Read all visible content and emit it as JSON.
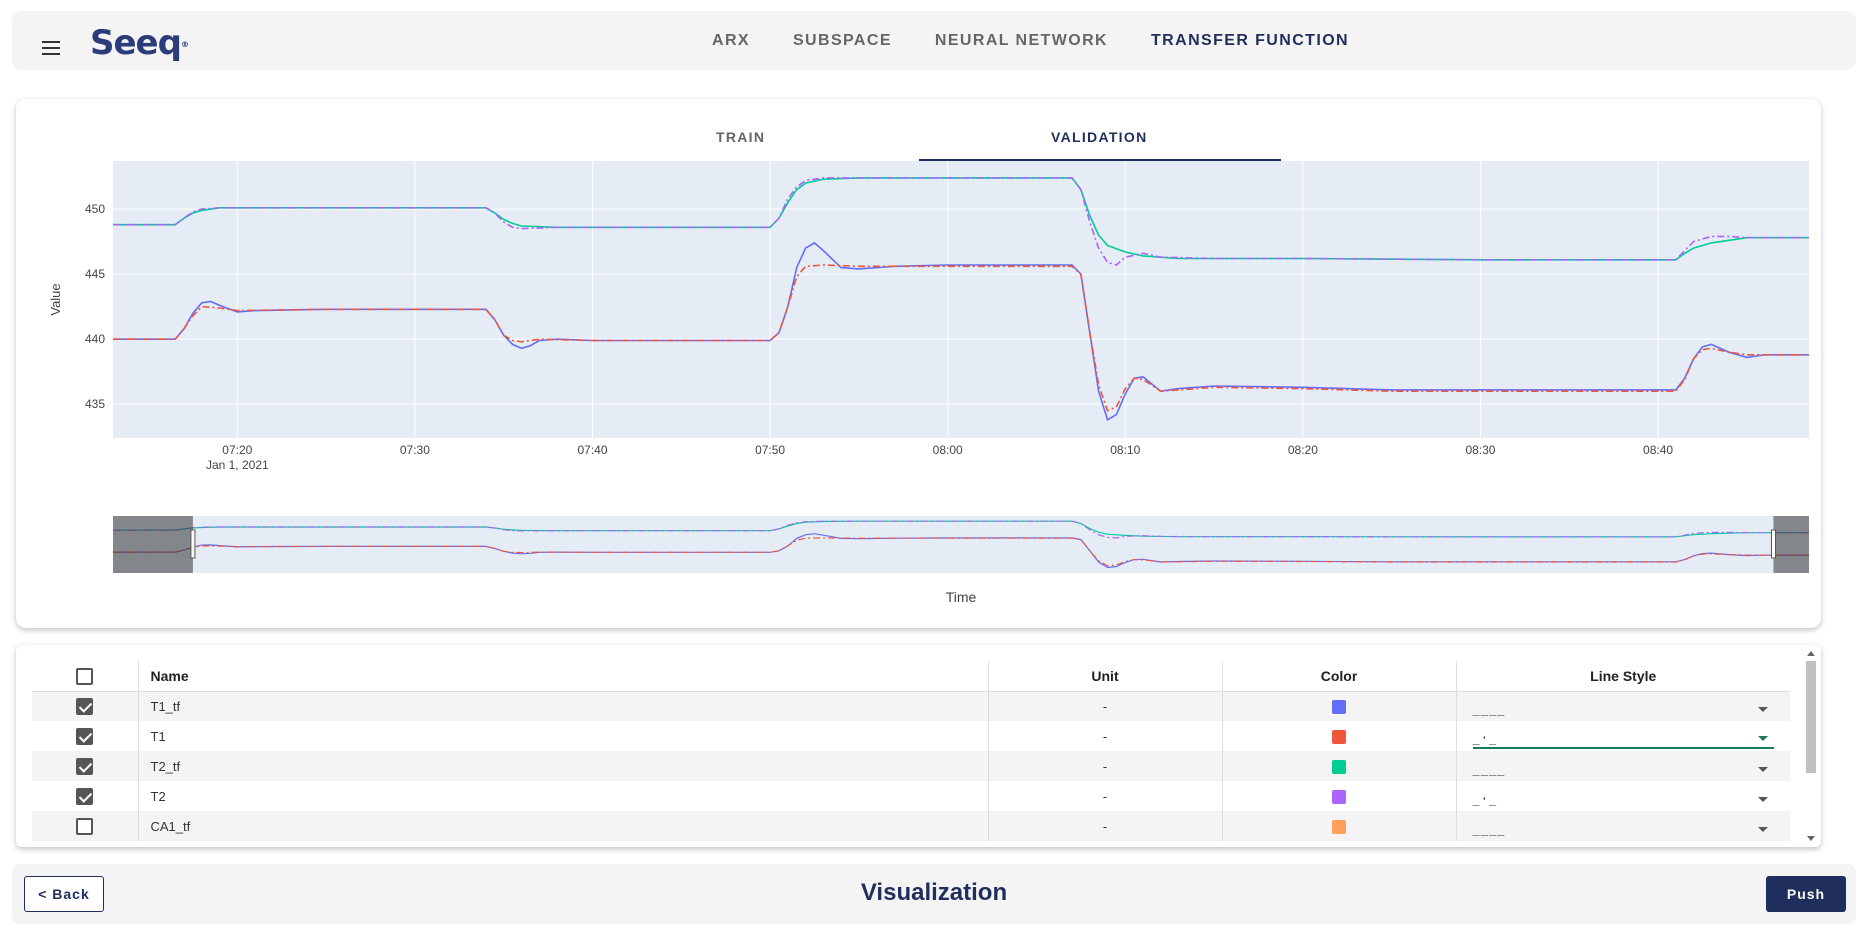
{
  "app": {
    "logo_text": "Seeq"
  },
  "nav": {
    "tabs": [
      {
        "label": "ARX",
        "active": false
      },
      {
        "label": "SUBSPACE",
        "active": false
      },
      {
        "label": "NEURAL NETWORK",
        "active": false
      },
      {
        "label": "TRANSFER FUNCTION",
        "active": true
      }
    ]
  },
  "subtabs": [
    {
      "label": "TRAIN",
      "active": false
    },
    {
      "label": "VALIDATION",
      "active": true
    }
  ],
  "chart_data": {
    "type": "line",
    "xlabel": "Time",
    "ylabel": "Value",
    "x_ticks": [
      "07:20",
      "07:30",
      "07:40",
      "07:50",
      "08:00",
      "08:10",
      "08:20",
      "08:30",
      "08:40"
    ],
    "x_date_label": "Jan 1, 2021",
    "y_ticks": [
      435,
      440,
      445,
      450
    ],
    "xlim": [
      "07:13",
      "08:48.5"
    ],
    "ylim": [
      432.4,
      453.7
    ],
    "grid": true,
    "rangeslider": true,
    "series": [
      {
        "name": "T1_tf",
        "color": "#636efa",
        "dash": "solid",
        "points": [
          [
            "07:13",
            440.0
          ],
          [
            "07:16.5",
            440.0
          ],
          [
            "07:17",
            440.8
          ],
          [
            "07:17.5",
            442.0
          ],
          [
            "07:18",
            442.8
          ],
          [
            "07:18.5",
            442.9
          ],
          [
            "07:19",
            442.6
          ],
          [
            "07:20",
            442.1
          ],
          [
            "07:21",
            442.2
          ],
          [
            "07:25",
            442.3
          ],
          [
            "07:30",
            442.3
          ],
          [
            "07:34",
            442.3
          ],
          [
            "07:34.5",
            441.5
          ],
          [
            "07:35",
            440.3
          ],
          [
            "07:35.5",
            439.6
          ],
          [
            "07:36",
            439.3
          ],
          [
            "07:36.5",
            439.5
          ],
          [
            "07:37",
            439.9
          ],
          [
            "07:38",
            440.0
          ],
          [
            "07:40",
            439.9
          ],
          [
            "07:45",
            439.9
          ],
          [
            "07:50",
            439.9
          ],
          [
            "07:50.5",
            440.5
          ],
          [
            "07:51",
            442.5
          ],
          [
            "07:51.5",
            445.5
          ],
          [
            "07:52",
            447.0
          ],
          [
            "07:52.5",
            447.4
          ],
          [
            "07:53",
            446.8
          ],
          [
            "07:54",
            445.5
          ],
          [
            "07:55",
            445.4
          ],
          [
            "07:57",
            445.6
          ],
          [
            "08:00",
            445.7
          ],
          [
            "08:05",
            445.7
          ],
          [
            "08:07",
            445.7
          ],
          [
            "08:07.5",
            445.0
          ],
          [
            "08:08",
            440.5
          ],
          [
            "08:08.5",
            436.0
          ],
          [
            "08:09",
            433.8
          ],
          [
            "08:09.5",
            434.2
          ],
          [
            "08:10",
            435.8
          ],
          [
            "08:10.5",
            437.0
          ],
          [
            "08:11",
            437.1
          ],
          [
            "08:12",
            436.0
          ],
          [
            "08:13",
            436.2
          ],
          [
            "08:15",
            436.4
          ],
          [
            "08:20",
            436.3
          ],
          [
            "08:25",
            436.1
          ],
          [
            "08:30",
            436.1
          ],
          [
            "08:35",
            436.1
          ],
          [
            "08:41",
            436.1
          ],
          [
            "08:41.5",
            437.0
          ],
          [
            "08:42",
            438.5
          ],
          [
            "08:42.5",
            439.4
          ],
          [
            "08:43",
            439.6
          ],
          [
            "08:44",
            439.0
          ],
          [
            "08:45",
            438.6
          ],
          [
            "08:46",
            438.8
          ],
          [
            "08:48.5",
            438.8
          ]
        ]
      },
      {
        "name": "T1",
        "color": "#ef553b",
        "dash": "dashdot",
        "points": [
          [
            "07:13",
            440.0
          ],
          [
            "07:16.5",
            440.0
          ],
          [
            "07:17",
            440.8
          ],
          [
            "07:17.5",
            441.8
          ],
          [
            "07:18",
            442.5
          ],
          [
            "07:19",
            442.4
          ],
          [
            "07:20",
            442.2
          ],
          [
            "07:25",
            442.3
          ],
          [
            "07:34",
            442.3
          ],
          [
            "07:34.5",
            441.5
          ],
          [
            "07:35",
            440.3
          ],
          [
            "07:35.5",
            439.9
          ],
          [
            "07:36",
            439.8
          ],
          [
            "07:37",
            440.0
          ],
          [
            "07:40",
            439.9
          ],
          [
            "07:50",
            439.9
          ],
          [
            "07:50.5",
            440.5
          ],
          [
            "07:51",
            442.5
          ],
          [
            "07:51.5",
            444.8
          ],
          [
            "07:52",
            445.6
          ],
          [
            "07:53",
            445.7
          ],
          [
            "07:55",
            445.6
          ],
          [
            "08:00",
            445.6
          ],
          [
            "08:07",
            445.6
          ],
          [
            "08:07.5",
            445.0
          ],
          [
            "08:08",
            440.5
          ],
          [
            "08:08.5",
            436.5
          ],
          [
            "08:09",
            434.5
          ],
          [
            "08:09.5",
            434.8
          ],
          [
            "08:10",
            436.2
          ],
          [
            "08:10.5",
            437.0
          ],
          [
            "08:11",
            436.9
          ],
          [
            "08:12",
            436.0
          ],
          [
            "08:13",
            436.1
          ],
          [
            "08:15",
            436.3
          ],
          [
            "08:20",
            436.2
          ],
          [
            "08:25",
            436.0
          ],
          [
            "08:30",
            436.0
          ],
          [
            "08:41",
            436.0
          ],
          [
            "08:41.5",
            436.9
          ],
          [
            "08:42",
            438.5
          ],
          [
            "08:42.5",
            439.2
          ],
          [
            "08:43",
            439.3
          ],
          [
            "08:44",
            439.0
          ],
          [
            "08:45",
            438.8
          ],
          [
            "08:48.5",
            438.8
          ]
        ]
      },
      {
        "name": "T2_tf",
        "color": "#00cc96",
        "dash": "solid",
        "points": [
          [
            "07:13",
            448.8
          ],
          [
            "07:16.5",
            448.8
          ],
          [
            "07:17",
            449.3
          ],
          [
            "07:17.5",
            449.7
          ],
          [
            "07:18",
            449.9
          ],
          [
            "07:19",
            450.1
          ],
          [
            "07:20",
            450.1
          ],
          [
            "07:30",
            450.1
          ],
          [
            "07:34",
            450.1
          ],
          [
            "07:34.5",
            449.7
          ],
          [
            "07:35",
            449.2
          ],
          [
            "07:35.5",
            448.9
          ],
          [
            "07:36",
            448.7
          ],
          [
            "07:38",
            448.6
          ],
          [
            "07:45",
            448.6
          ],
          [
            "07:50",
            448.6
          ],
          [
            "07:50.5",
            449.3
          ],
          [
            "07:51",
            450.5
          ],
          [
            "07:51.5",
            451.5
          ],
          [
            "07:52",
            452.0
          ],
          [
            "07:53",
            452.3
          ],
          [
            "07:55",
            452.4
          ],
          [
            "08:00",
            452.4
          ],
          [
            "08:07",
            452.4
          ],
          [
            "08:07.5",
            451.5
          ],
          [
            "08:08",
            449.5
          ],
          [
            "08:08.5",
            448.0
          ],
          [
            "08:09",
            447.2
          ],
          [
            "08:10",
            446.7
          ],
          [
            "08:11",
            446.4
          ],
          [
            "08:13",
            446.2
          ],
          [
            "08:20",
            446.2
          ],
          [
            "08:30",
            446.1
          ],
          [
            "08:41",
            446.1
          ],
          [
            "08:41.5",
            446.6
          ],
          [
            "08:42",
            447.0
          ],
          [
            "08:43",
            447.4
          ],
          [
            "08:44",
            447.6
          ],
          [
            "08:45",
            447.8
          ],
          [
            "08:48.5",
            447.8
          ]
        ]
      },
      {
        "name": "T2",
        "color": "#ab63fa",
        "dash": "dashdot",
        "points": [
          [
            "07:13",
            448.8
          ],
          [
            "07:16.5",
            448.8
          ],
          [
            "07:17",
            449.3
          ],
          [
            "07:17.5",
            449.8
          ],
          [
            "07:18",
            450.0
          ],
          [
            "07:19",
            450.1
          ],
          [
            "07:30",
            450.1
          ],
          [
            "07:34",
            450.1
          ],
          [
            "07:34.5",
            449.7
          ],
          [
            "07:35",
            449.0
          ],
          [
            "07:35.5",
            448.6
          ],
          [
            "07:36",
            448.5
          ],
          [
            "07:38",
            448.6
          ],
          [
            "07:50",
            448.6
          ],
          [
            "07:50.5",
            449.3
          ],
          [
            "07:51",
            450.8
          ],
          [
            "07:51.5",
            451.7
          ],
          [
            "07:52",
            452.2
          ],
          [
            "07:53",
            452.4
          ],
          [
            "08:00",
            452.4
          ],
          [
            "08:07",
            452.4
          ],
          [
            "08:07.5",
            451.5
          ],
          [
            "08:08",
            449.0
          ],
          [
            "08:08.5",
            447.0
          ],
          [
            "08:09",
            445.9
          ],
          [
            "08:09.5",
            445.7
          ],
          [
            "08:10",
            446.3
          ],
          [
            "08:11",
            446.6
          ],
          [
            "08:12",
            446.3
          ],
          [
            "08:15",
            446.2
          ],
          [
            "08:20",
            446.2
          ],
          [
            "08:30",
            446.1
          ],
          [
            "08:41",
            446.1
          ],
          [
            "08:41.5",
            446.8
          ],
          [
            "08:42",
            447.5
          ],
          [
            "08:43",
            447.9
          ],
          [
            "08:44",
            447.9
          ],
          [
            "08:45",
            447.8
          ],
          [
            "08:48.5",
            447.8
          ]
        ]
      }
    ]
  },
  "table": {
    "headers": {
      "name": "Name",
      "unit": "Unit",
      "color": "Color",
      "line_style": "Line Style"
    },
    "rows": [
      {
        "checked": true,
        "name": "T1_tf",
        "unit": "-",
        "color": "#636efa",
        "line_style": "____",
        "focused": false
      },
      {
        "checked": true,
        "name": "T1",
        "unit": "-",
        "color": "#ef553b",
        "line_style": "_·_",
        "focused": true
      },
      {
        "checked": true,
        "name": "T2_tf",
        "unit": "-",
        "color": "#00cc96",
        "line_style": "____",
        "focused": false
      },
      {
        "checked": true,
        "name": "T2",
        "unit": "-",
        "color": "#ab63fa",
        "line_style": "_·_",
        "focused": false
      },
      {
        "checked": false,
        "name": "CA1_tf",
        "unit": "-",
        "color": "#ffa15a",
        "line_style": "____",
        "focused": false
      }
    ]
  },
  "footer": {
    "back_label": "< Back",
    "title": "Visualization",
    "push_label": "Push"
  }
}
